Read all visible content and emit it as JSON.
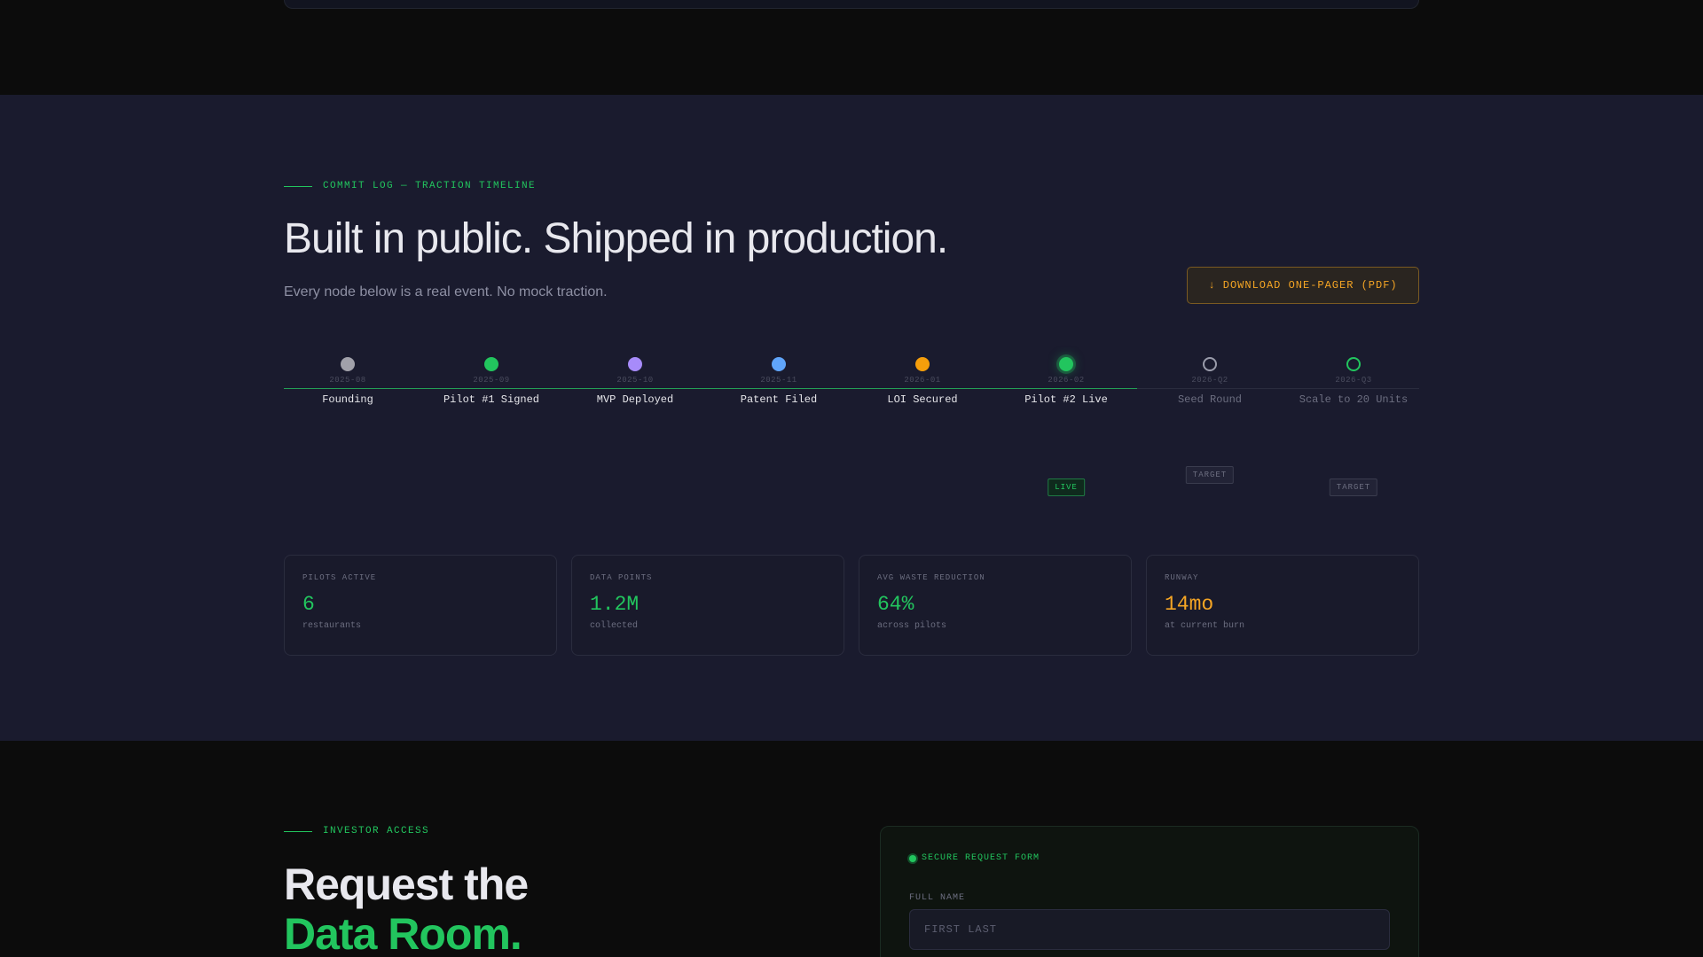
{
  "traction": {
    "eyebrow": "COMMIT LOG — TRACTION TIMELINE",
    "title": "Built in public. Shipped in production.",
    "subtitle": "Every node below is a real event. No mock traction.",
    "download_label": "↓ DOWNLOAD ONE-PAGER (PDF)",
    "timeline": [
      {
        "date": "2025-08",
        "label": "Founding",
        "color": "#a1a1aa",
        "state": "done"
      },
      {
        "date": "2025-09",
        "label": "Pilot #1 Signed",
        "color": "#22c55e",
        "state": "done"
      },
      {
        "date": "2025-10",
        "label": "MVP Deployed",
        "color": "#a78bfa",
        "state": "done"
      },
      {
        "date": "2025-11",
        "label": "Patent Filed",
        "color": "#60a5fa",
        "state": "done"
      },
      {
        "date": "2026-01",
        "label": "LOI Secured",
        "color": "#f59e0b",
        "state": "done"
      },
      {
        "date": "2026-02",
        "label": "Pilot #2 Live",
        "color": "#22c55e",
        "state": "live",
        "badge": "LIVE"
      },
      {
        "date": "2026-Q2",
        "label": "Seed Round",
        "color": "#9a9cab",
        "state": "target",
        "badge": "TARGET"
      },
      {
        "date": "2026-Q3",
        "label": "Scale to 20 Units",
        "color": "#22c55e",
        "state": "target",
        "badge": "TARGET"
      }
    ],
    "stats": [
      {
        "key": "PILOTS ACTIVE",
        "value": "6",
        "note": "restaurants",
        "color": "#22c55e"
      },
      {
        "key": "DATA POINTS",
        "value": "1.2M",
        "note": "collected",
        "color": "#22c55e"
      },
      {
        "key": "AVG WASTE REDUCTION",
        "value": "64%",
        "note": "across pilots",
        "color": "#22c55e"
      },
      {
        "key": "RUNWAY",
        "value": "14mo",
        "note": "at current burn",
        "color": "#f5a524"
      }
    ]
  },
  "investor": {
    "eyebrow": "INVESTOR ACCESS",
    "title_line1": "Request the",
    "title_line2": "Data Room.",
    "form_title": "SECURE REQUEST FORM",
    "full_name_label": "FULL NAME",
    "full_name_placeholder": "FIRST LAST",
    "full_name_value": ""
  }
}
